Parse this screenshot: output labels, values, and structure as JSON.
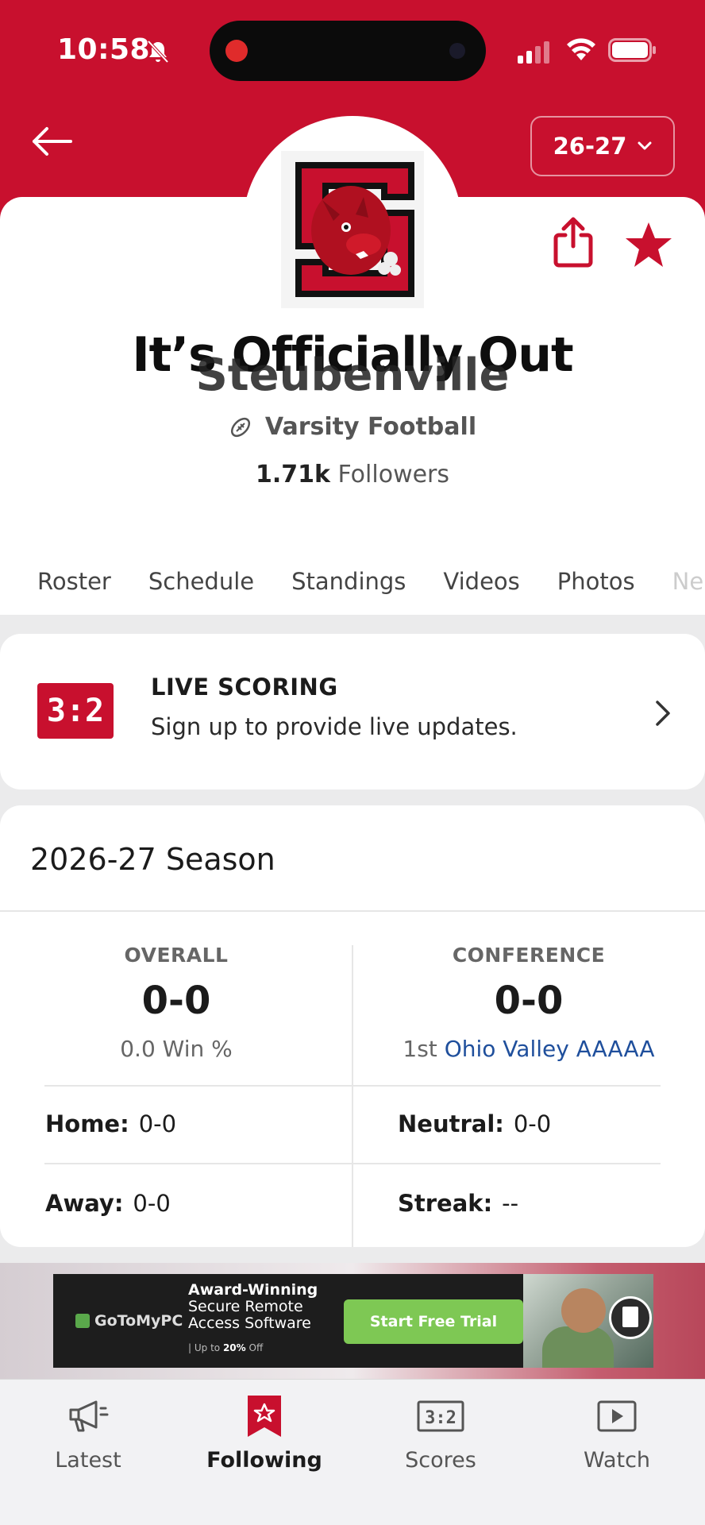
{
  "status_bar": {
    "time": "10:58"
  },
  "header": {
    "season_selector": "26-27"
  },
  "team": {
    "overlay_title": "It’s Officially Out",
    "name": "Steubenville",
    "sport": "Varsity Football",
    "followers_count": "1.71k",
    "followers_label": "Followers"
  },
  "tabs": [
    "Roster",
    "Schedule",
    "Standings",
    "Videos",
    "Photos",
    "Ne"
  ],
  "live_scoring": {
    "badge": "3:2",
    "title": "LIVE SCORING",
    "subtitle": "Sign up to provide live updates."
  },
  "season": {
    "title": "2026-27 Season",
    "overall": {
      "label": "OVERALL",
      "record": "0-0",
      "sub": "0.0 Win %"
    },
    "conference": {
      "label": "CONFERENCE",
      "record": "0-0",
      "rank": "1st",
      "name": "Ohio Valley AAAAA"
    },
    "home": {
      "label": "Home:",
      "value": "0-0"
    },
    "neutral": {
      "label": "Neutral:",
      "value": "0-0"
    },
    "away": {
      "label": "Away:",
      "value": "0-0"
    },
    "streak": {
      "label": "Streak:",
      "value": "--"
    }
  },
  "ad": {
    "brand": "GoToMyPC",
    "headline_line1": "Award-Winning",
    "headline_line2": "Secure Remote",
    "headline_line3": "Access Software",
    "fine_print_prefix": "| Up to",
    "fine_print_bold": "20%",
    "fine_print_suffix": "Off",
    "cta": "Start Free Trial"
  },
  "bottom_nav": {
    "latest": "Latest",
    "following": "Following",
    "scores": "Scores",
    "watch": "Watch"
  },
  "colors": {
    "brand_red": "#c8102e",
    "link_blue": "#1f4f9c"
  }
}
